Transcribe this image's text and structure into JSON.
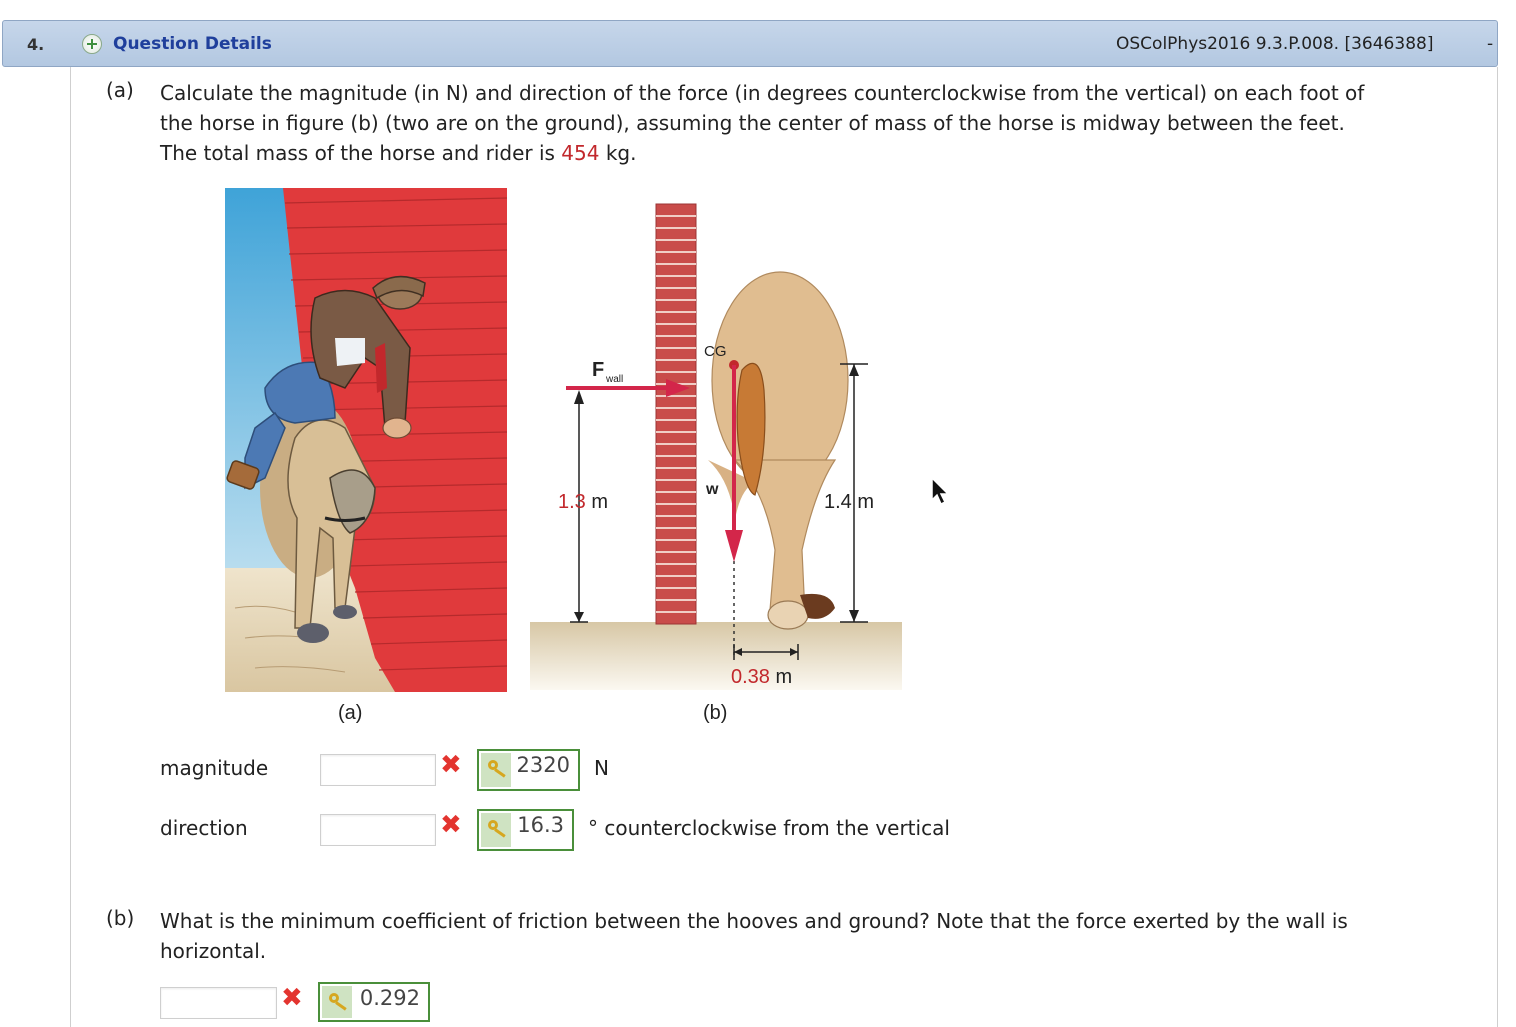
{
  "header": {
    "number": "4.",
    "details_label": "Question Details",
    "reference": "OSColPhys2016 9.3.P.008. [3646388]",
    "collapse": "-"
  },
  "part_a": {
    "label": "(a)",
    "line1": "Calculate the magnitude (in N) and direction of the force (in degrees counterclockwise from the vertical) on each foot of",
    "line2": "the horse in figure (b) (two are on the ground), assuming the center of mass of the horse is midway between the feet.",
    "line3_pre": "The total mass of the horse and rider is ",
    "mass": "454",
    "line3_post": " kg."
  },
  "figure": {
    "cap_a": "(a)",
    "cap_b": "(b)",
    "f_wall": "F",
    "f_wall_sub": "wall",
    "cg": "CG",
    "w": "w",
    "h1_value": "1.3",
    "h1_unit": " m",
    "h2": "1.4 m",
    "d_value": "0.38",
    "d_unit": " m"
  },
  "answers": {
    "magnitude_label": "magnitude",
    "magnitude_input": "",
    "magnitude_key": "2320",
    "magnitude_unit": "N",
    "direction_label": "direction",
    "direction_input": "",
    "direction_key": "16.3",
    "direction_unit": "° counterclockwise from the vertical"
  },
  "part_b": {
    "label": "(b)",
    "line1": "What is the minimum coefficient of friction between the hooves and ground? Note that the force exerted by the wall is",
    "line2": "horizontal.",
    "input": "",
    "key": "0.292"
  },
  "icons": {
    "expand": "plus-circle-icon",
    "wrong": "x-mark-icon",
    "key": "key-icon",
    "cursor": "mouse-pointer-icon"
  },
  "colors": {
    "header_bg": "#b3c8e1",
    "link": "#1f3f9c",
    "highlight_red": "#c2282c",
    "wrong": "#e3342f",
    "key_border": "#4a8f3a"
  }
}
